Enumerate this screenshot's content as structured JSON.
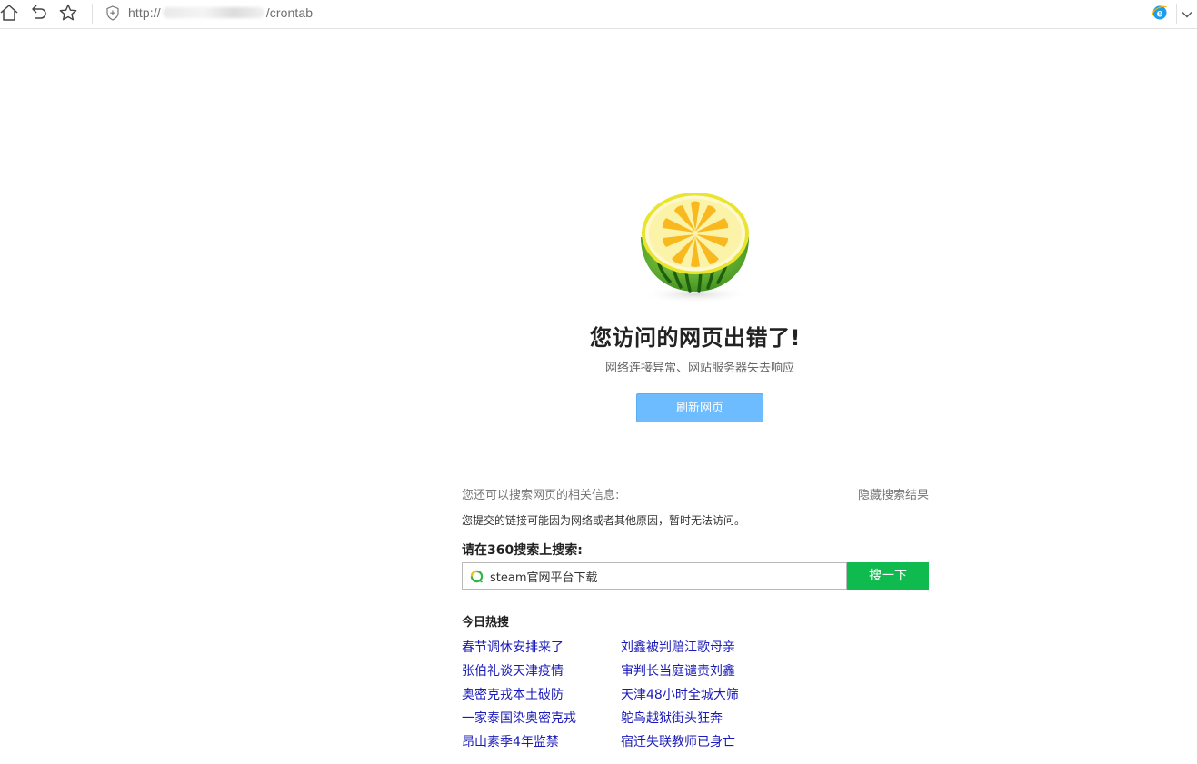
{
  "browser": {
    "url_prefix": "http://",
    "url_suffix": "/crontab"
  },
  "error": {
    "title": "您访问的网页出错了!",
    "subtitle": "网络连接异常、网站服务器失去响应",
    "refresh_label": "刷新网页"
  },
  "search_section": {
    "also_text": "您还可以搜索网页的相关信息:",
    "hide_label": "隐藏搜索结果",
    "reason_text": "您提交的链接可能因为网络或者其他原因，暂时无法访问。",
    "search_label": "请在360搜索上搜索:",
    "query": "steam官网平台下载",
    "search_button": "搜一下"
  },
  "hot": {
    "title": "今日热搜",
    "left": [
      "春节调休安排来了",
      "张伯礼谈天津疫情",
      "奥密克戎本土破防",
      "一家泰国染奥密克戎",
      "昂山素季4年监禁"
    ],
    "right": [
      "刘鑫被判赔江歌母亲",
      "审判长当庭谴责刘鑫",
      "天津48小时全城大筛",
      "鸵鸟越狱街头狂奔",
      "宿迁失联教师已身亡"
    ]
  },
  "colors": {
    "refresh_button": "#6cbcff",
    "search_button": "#0fbb4f",
    "hot_link": "#1a1ab8"
  },
  "icons": [
    "home-icon",
    "back-icon",
    "favorite-star-icon",
    "security-shield-icon",
    "ie-compat-icon",
    "dropdown-chevron-icon",
    "watermelon-lemon-illustration",
    "search360-logo-icon"
  ]
}
